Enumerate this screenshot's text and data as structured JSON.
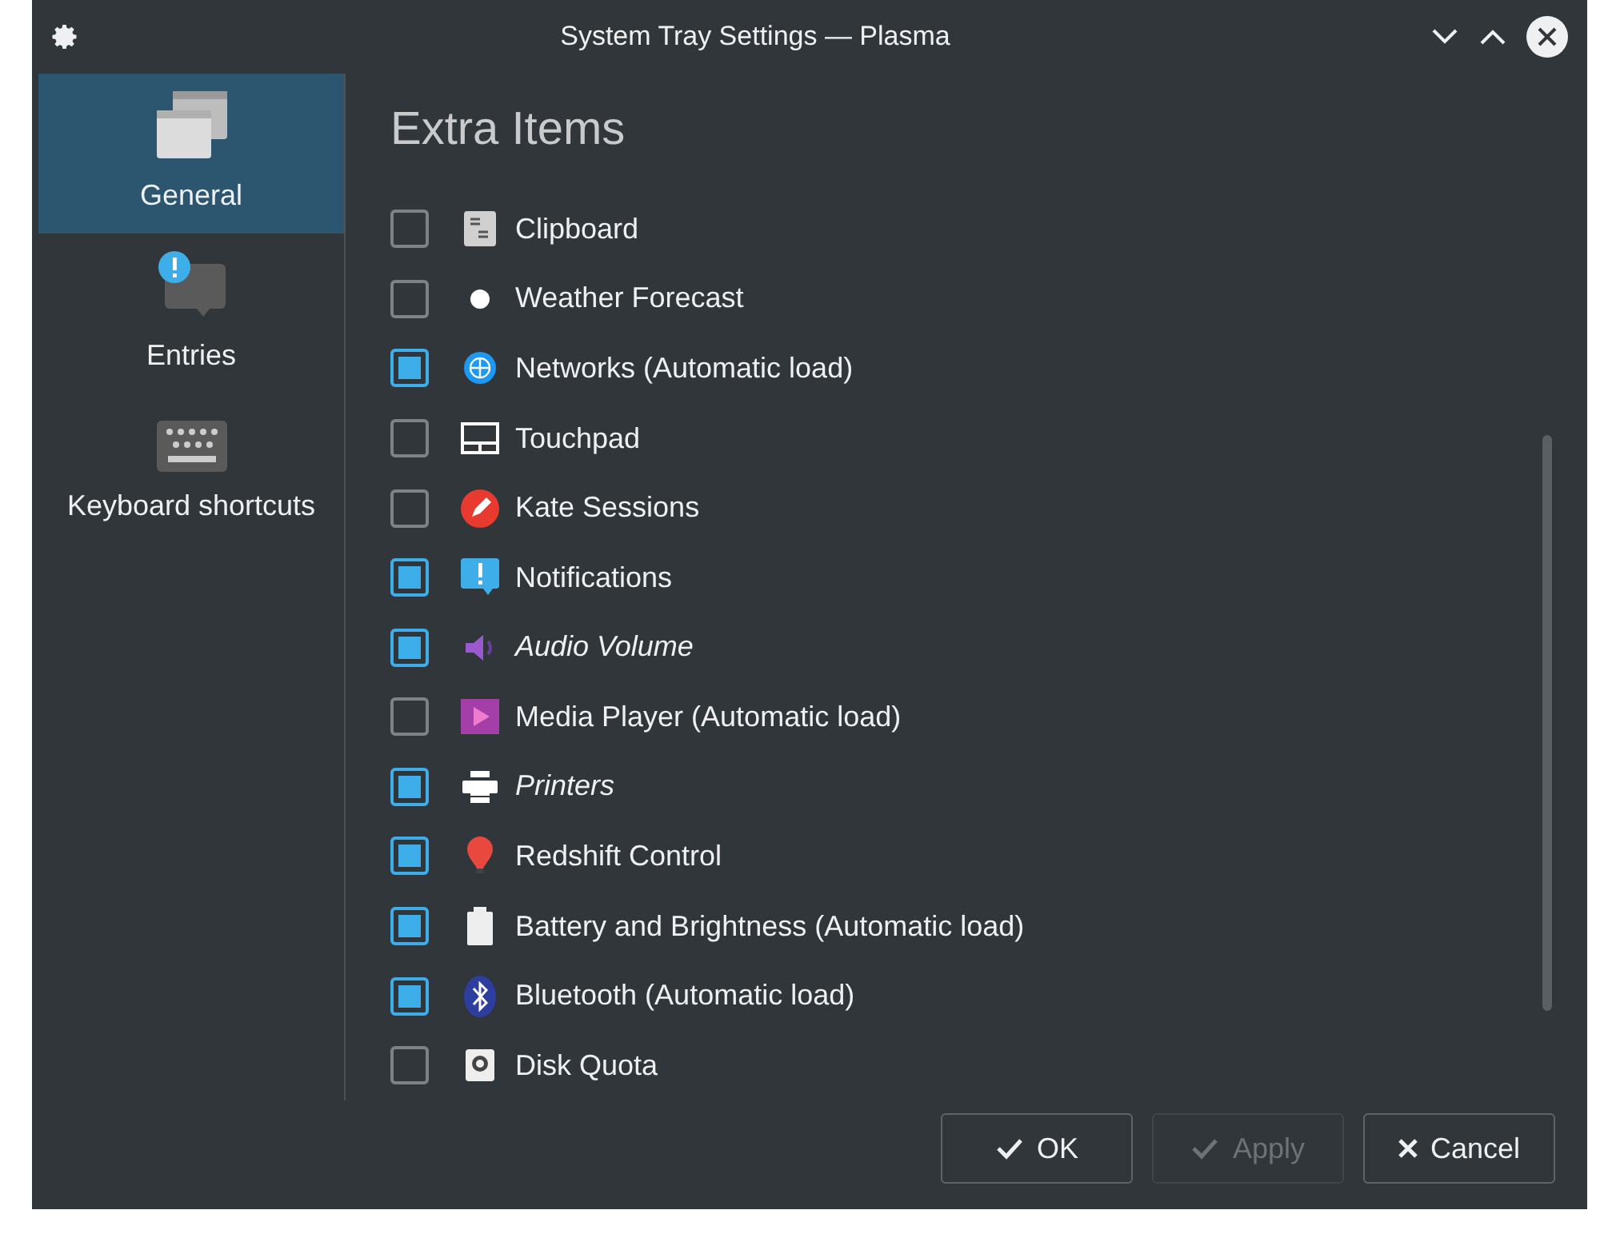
{
  "window": {
    "title": "System Tray Settings — Plasma"
  },
  "sidebar": {
    "items": [
      {
        "label": "General",
        "selected": true
      },
      {
        "label": "Entries",
        "selected": false
      },
      {
        "label": "Keyboard shortcuts",
        "selected": false
      }
    ]
  },
  "page": {
    "heading": "Extra Items",
    "items": [
      {
        "label": "Clipboard",
        "checked": false,
        "italic": false
      },
      {
        "label": "Weather Forecast",
        "checked": false,
        "italic": false
      },
      {
        "label": "Networks (Automatic load)",
        "checked": true,
        "italic": false
      },
      {
        "label": "Touchpad",
        "checked": false,
        "italic": false
      },
      {
        "label": "Kate Sessions",
        "checked": false,
        "italic": false
      },
      {
        "label": "Notifications",
        "checked": true,
        "italic": false
      },
      {
        "label": "Audio Volume",
        "checked": true,
        "italic": true
      },
      {
        "label": "Media Player (Automatic load)",
        "checked": false,
        "italic": false
      },
      {
        "label": "Printers",
        "checked": true,
        "italic": true
      },
      {
        "label": "Redshift Control",
        "checked": true,
        "italic": false
      },
      {
        "label": "Battery and Brightness (Automatic load)",
        "checked": true,
        "italic": false
      },
      {
        "label": "Bluetooth (Automatic load)",
        "checked": true,
        "italic": false
      },
      {
        "label": "Disk Quota",
        "checked": false,
        "italic": false
      }
    ]
  },
  "buttons": [
    {
      "label": "OK",
      "kind": "ok",
      "disabled": false
    },
    {
      "label": "Apply",
      "kind": "apply",
      "disabled": true
    },
    {
      "label": "Cancel",
      "kind": "cancel",
      "disabled": false
    }
  ]
}
